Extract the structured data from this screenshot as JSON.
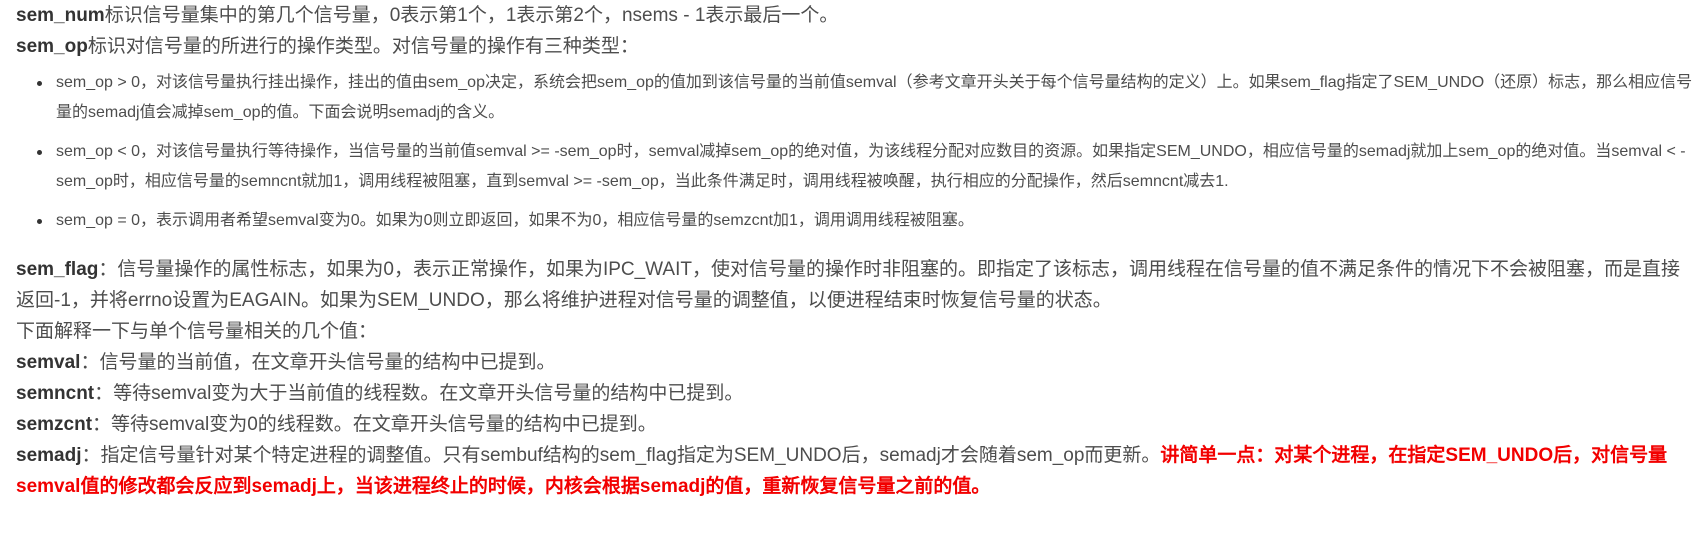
{
  "sem_num": {
    "term": "sem_num",
    "text": "标识信号量集中的第几个信号量，0表示第1个，1表示第2个，nsems - 1表示最后一个。"
  },
  "sem_op": {
    "term": "sem_op",
    "text": "标识对信号量的所进行的操作类型。对信号量的操作有三种类型：",
    "items": [
      "sem_op > 0，对该信号量执行挂出操作，挂出的值由sem_op决定，系统会把sem_op的值加到该信号量的当前值semval（参考文章开头关于每个信号量结构的定义）上。如果sem_flag指定了SEM_UNDO（还原）标志，那么相应信号量的semadj值会减掉sem_op的值。下面会说明semadj的含义。",
      "sem_op < 0，对该信号量执行等待操作，当信号量的当前值semval >= -sem_op时，semval减掉sem_op的绝对值，为该线程分配对应数目的资源。如果指定SEM_UNDO，相应信号量的semadj就加上sem_op的绝对值。当semval < -sem_op时，相应信号量的semncnt就加1，调用线程被阻塞，直到semval >= -sem_op，当此条件满足时，调用线程被唤醒，执行相应的分配操作，然后semncnt减去1.",
      "sem_op = 0，表示调用者希望semval变为0。如果为0则立即返回，如果不为0，相应信号量的semzcnt加1，调用调用线程被阻塞。"
    ]
  },
  "sem_flag": {
    "term": "sem_flag",
    "text": "：信号量操作的属性标志，如果为0，表示正常操作，如果为IPC_WAIT，使对信号量的操作时非阻塞的。即指定了该标志，调用线程在信号量的值不满足条件的情况下不会被阻塞，而是直接返回-1，并将errno设置为EAGAIN。如果为SEM_UNDO，那么将维护进程对信号量的调整值，以便进程结束时恢复信号量的状态。"
  },
  "values_intro": "下面解释一下与单个信号量相关的几个值：",
  "semval": {
    "term": "semval",
    "text": "：信号量的当前值，在文章开头信号量的结构中已提到。"
  },
  "semncnt": {
    "term": "semncnt",
    "text": "：等待semval变为大于当前值的线程数。在文章开头信号量的结构中已提到。"
  },
  "semzcnt": {
    "term": "semzcnt",
    "text": "：等待semval变为0的线程数。在文章开头信号量的结构中已提到。"
  },
  "semadj": {
    "term": "semadj",
    "text": "：指定信号量针对某个特定进程的调整值。只有sembuf结构的sem_flag指定为SEM_UNDO后，semadj才会随着sem_op而更新。",
    "highlight": "讲简单一点：对某个进程，在指定SEM_UNDO后，对信号量semval值的修改都会反应到semadj上，当该进程终止的时候，内核会根据semadj的值，重新恢复信号量之前的值。"
  }
}
